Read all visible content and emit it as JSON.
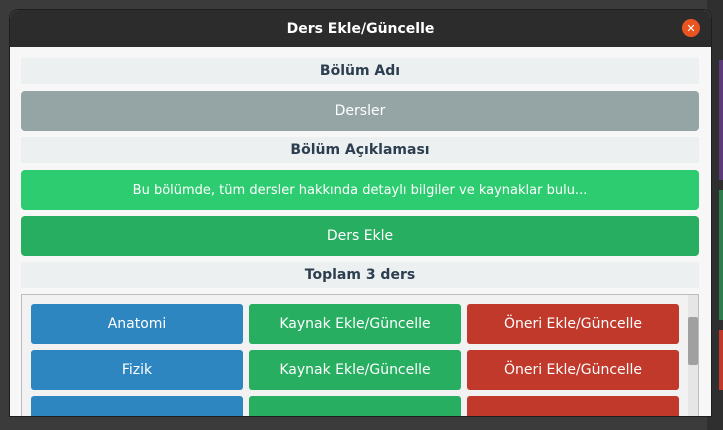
{
  "window": {
    "title": "Ders Ekle/Güncelle",
    "close_glyph": "✕"
  },
  "section_name": {
    "label": "Bölüm Adı",
    "value": "Dersler"
  },
  "section_description": {
    "label": "Bölüm Açıklaması",
    "value": "Bu bölümde, tüm dersler hakkında detaylı bilgiler ve kaynaklar bulu..."
  },
  "add_course_button": "Ders Ekle",
  "total_label": "Toplam 3 ders",
  "courses": [
    {
      "name": "Anatomi",
      "resource_label": "Kaynak Ekle/Güncelle",
      "suggestion_label": "Öneri Ekle/Güncelle"
    },
    {
      "name": "Fizik",
      "resource_label": "Kaynak Ekle/Güncelle",
      "suggestion_label": "Öneri Ekle/Güncelle"
    },
    {
      "name": "",
      "resource_label": "",
      "suggestion_label": ""
    }
  ],
  "colors": {
    "course_button": "#2e86c1",
    "resource_button": "#27ae60",
    "suggestion_button": "#c0392b",
    "close_button": "#e95420"
  }
}
